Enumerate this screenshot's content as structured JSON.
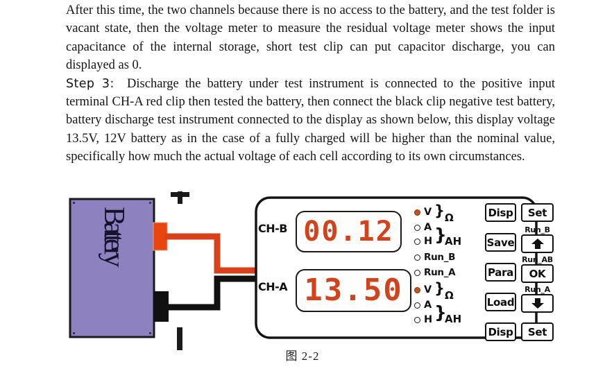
{
  "document": {
    "paragraphs": [
      "After this time, the two channels because there is no access to the battery, and the test folder is vacant state, then the voltage meter to measure the residual voltage meter shows the input capacitance of the internal storage, short test clip can put capacitor discharge, you can displayed as 0.",
      "Discharge the battery under test instrument is connected to the positive input terminal CH-A red clip then tested the battery, then connect the black clip negative test battery, battery discharge test instrument connected to the display as shown below, this display voltage 13.5V, 12V battery as in the case of a fully charged will be higher than the nominal value, specifically how much the actual voltage of each cell according to its own circumstances."
    ],
    "step_label": "Step 3:"
  },
  "figure": {
    "caption": "图 2-2",
    "battery": {
      "label": "Battery",
      "fill_color": "#8d81bf",
      "border_color": "#1a1a1a",
      "plus_symbol": "+",
      "minus_symbol": "−"
    },
    "wires": {
      "positive_color": "#d8411a",
      "negative_color": "#111111"
    },
    "panel": {
      "channels": [
        {
          "name": "CH-B",
          "display_value": "00.12"
        },
        {
          "name": "CH-A",
          "display_value": "13.50"
        }
      ],
      "leds": [
        {
          "label": "V",
          "on": true
        },
        {
          "label": "A",
          "on": false
        },
        {
          "label": "H",
          "on": false
        },
        {
          "label": "Run_B",
          "on": false
        },
        {
          "label": "Run_A",
          "on": false
        },
        {
          "label": "V",
          "on": true
        },
        {
          "label": "A",
          "on": false
        },
        {
          "label": "H",
          "on": false
        }
      ],
      "units": {
        "ohm": "Ω",
        "ah": "AH",
        "brace": "}"
      },
      "buttons_left": [
        "Disp",
        "Save",
        "Para",
        "Load",
        "Disp"
      ],
      "buttons_right": [
        {
          "label": "Set",
          "sub": ""
        },
        {
          "label": "up-arrow",
          "sub": "Run_B"
        },
        {
          "label": "OK",
          "sub": "Run_AB"
        },
        {
          "label": "down-arrow",
          "sub": "Run_A"
        },
        {
          "label": "Set",
          "sub": ""
        }
      ],
      "led_on_color": "#c6541f",
      "segment_color": "#d0431c"
    }
  }
}
